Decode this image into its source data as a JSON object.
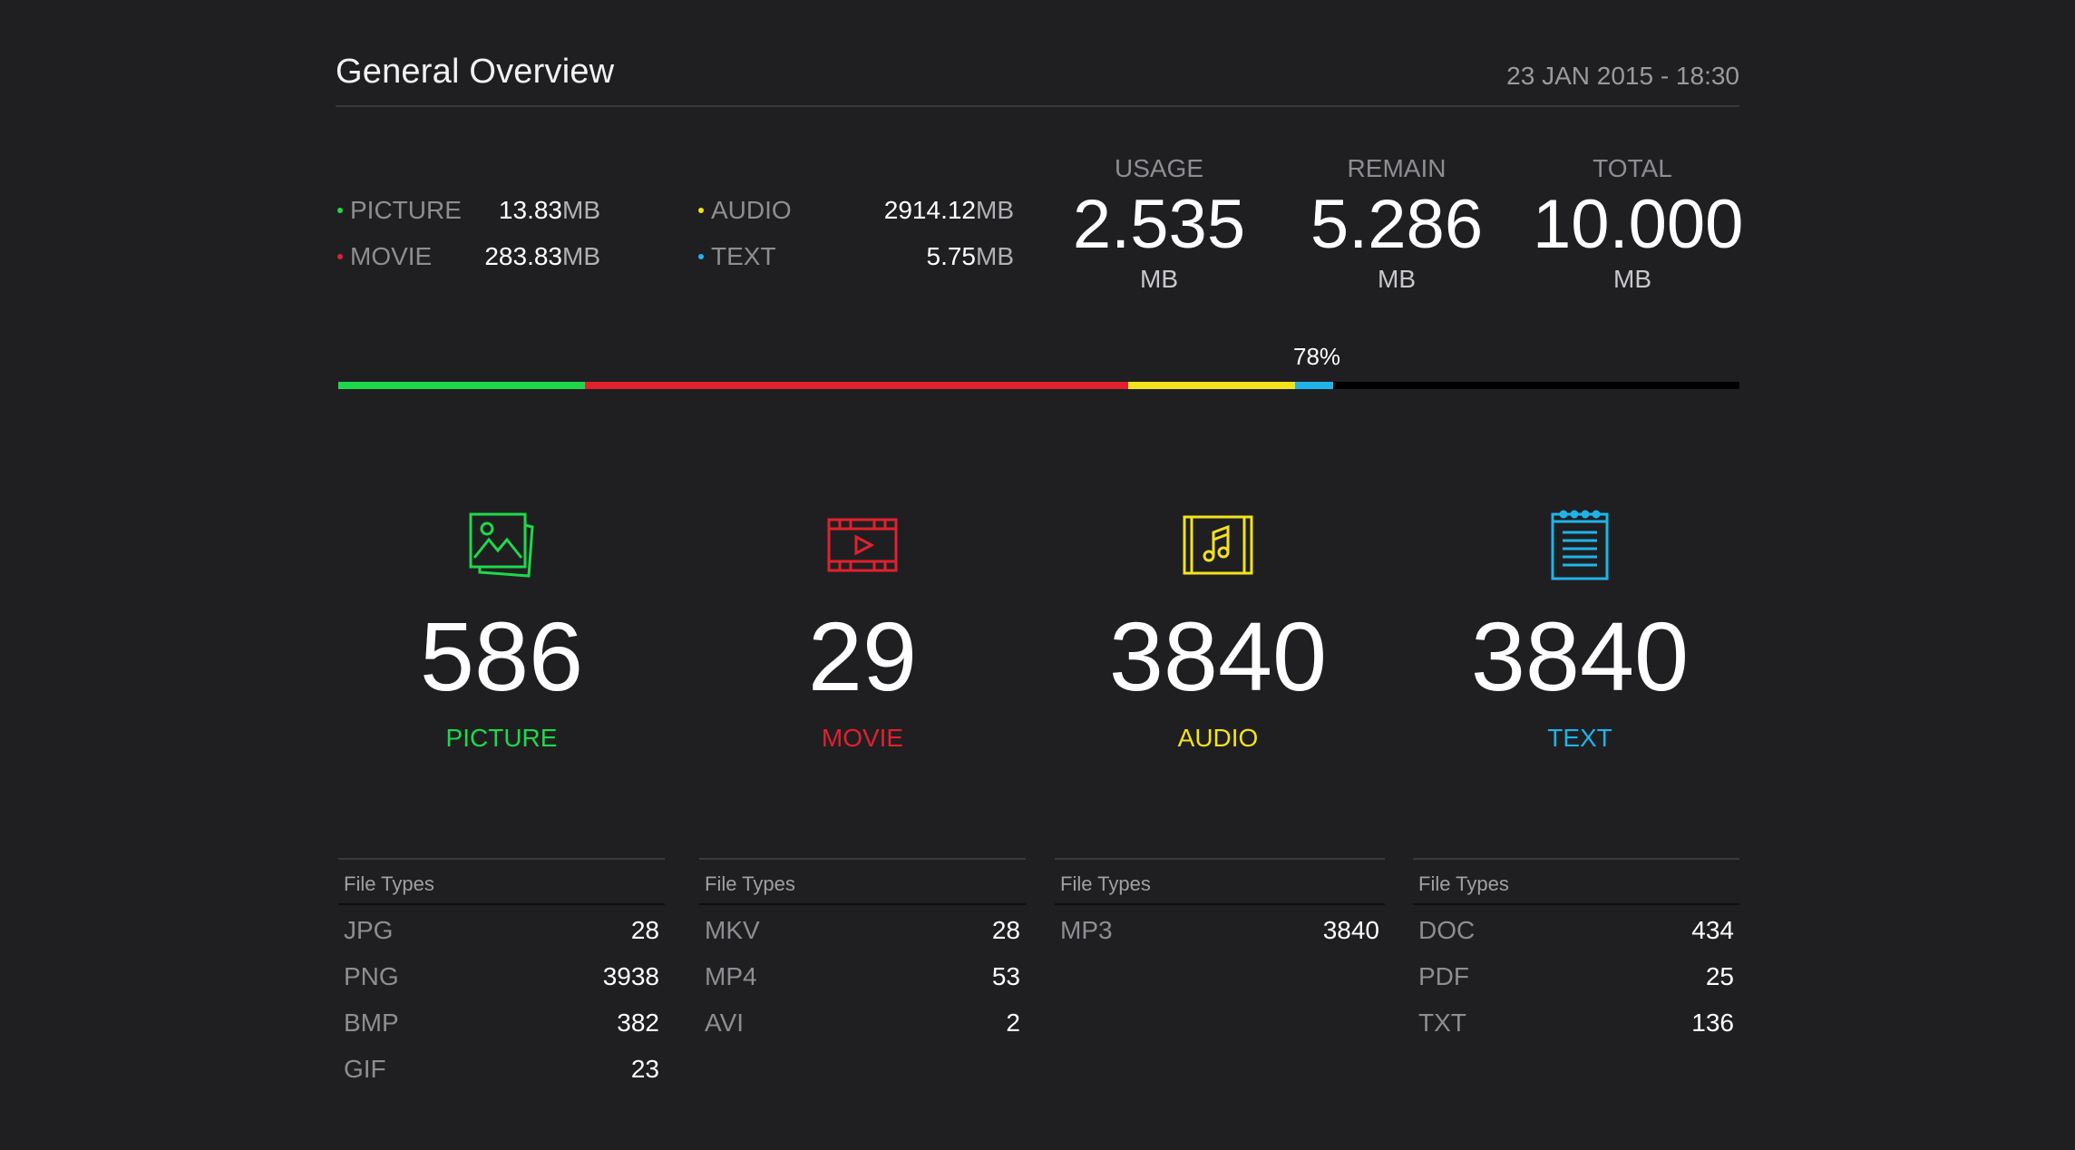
{
  "header": {
    "title": "General Overview",
    "datetime": "23 JAN 2015 - 18:30"
  },
  "legend": [
    {
      "name": "PICTURE",
      "value": "13.83",
      "unit": "MB",
      "color": "#1fd84a"
    },
    {
      "name": "MOVIE",
      "value": "283.83",
      "unit": "MB",
      "color": "#e0212d"
    },
    {
      "name": "AUDIO",
      "value": "2914.12",
      "unit": "MB",
      "color": "#f3e21c"
    },
    {
      "name": "TEXT",
      "value": "5.75",
      "unit": "MB",
      "color": "#1fb4e8"
    }
  ],
  "stats": {
    "usage": {
      "label": "USAGE",
      "value": "2.535",
      "unit": "MB"
    },
    "remain": {
      "label": "REMAIN",
      "value": "5.286",
      "unit": "MB"
    },
    "total": {
      "label": "TOTAL",
      "value": "10.000",
      "unit": "MB"
    }
  },
  "progress": {
    "percent_label": "78%",
    "segments": [
      {
        "category": "PICTURE",
        "fraction": 0.176,
        "color": "#1fd84a"
      },
      {
        "category": "MOVIE",
        "fraction": 0.388,
        "color": "#e0212d"
      },
      {
        "category": "AUDIO",
        "fraction": 0.119,
        "color": "#f3e21c"
      },
      {
        "category": "TEXT",
        "fraction": 0.027,
        "color": "#1fb4e8"
      }
    ]
  },
  "categories": [
    {
      "label": "PICTURE",
      "count": "586",
      "color": "#1fd84a",
      "icon": "picture-icon"
    },
    {
      "label": "MOVIE",
      "count": "29",
      "color": "#e0212d",
      "icon": "movie-icon"
    },
    {
      "label": "AUDIO",
      "count": "3840",
      "color": "#f3e21c",
      "icon": "audio-icon"
    },
    {
      "label": "TEXT",
      "count": "3840",
      "color": "#1fb4e8",
      "icon": "text-icon"
    }
  ],
  "file_types": [
    {
      "header": "File Types",
      "rows": [
        {
          "ext": "JPG",
          "count": "28"
        },
        {
          "ext": "PNG",
          "count": "3938"
        },
        {
          "ext": "BMP",
          "count": "382"
        },
        {
          "ext": "GIF",
          "count": "23"
        }
      ]
    },
    {
      "header": "File Types",
      "rows": [
        {
          "ext": "MKV",
          "count": "28"
        },
        {
          "ext": "MP4",
          "count": "53"
        },
        {
          "ext": "AVI",
          "count": "2"
        }
      ]
    },
    {
      "header": "File Types",
      "rows": [
        {
          "ext": "MP3",
          "count": "3840"
        }
      ]
    },
    {
      "header": "File Types",
      "rows": [
        {
          "ext": "DOC",
          "count": "434"
        },
        {
          "ext": "PDF",
          "count": "25"
        },
        {
          "ext": "TXT",
          "count": "136"
        }
      ]
    }
  ]
}
